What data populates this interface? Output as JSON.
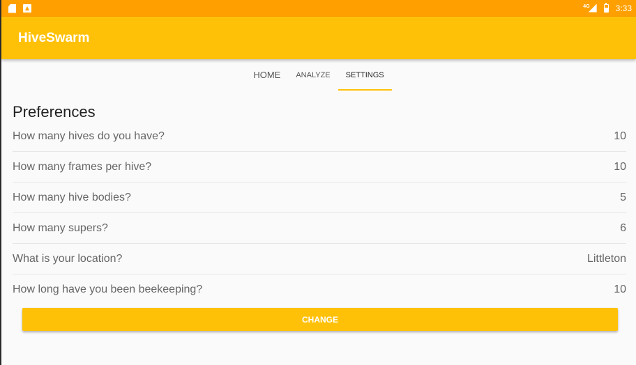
{
  "status_bar": {
    "net_type": "4G",
    "time": "3:33"
  },
  "app": {
    "title": "HiveSwarm"
  },
  "tabs": [
    {
      "label": "HOME"
    },
    {
      "label": "ANALYZE"
    },
    {
      "label": "SETTINGS",
      "selected": true
    }
  ],
  "preferences": {
    "title": "Preferences",
    "rows": [
      {
        "question": "How many hives do you have?",
        "value": "10"
      },
      {
        "question": "How many frames per hive?",
        "value": "10"
      },
      {
        "question": "How many hive bodies?",
        "value": "5"
      },
      {
        "question": "How many supers?",
        "value": "6"
      },
      {
        "question": "What is your location?",
        "value": "Littleton"
      },
      {
        "question": "How long have you been beekeeping?",
        "value": "10"
      }
    ],
    "change_label": "CHANGE"
  },
  "colors": {
    "status_bar": "#ffa000",
    "primary": "#ffc107",
    "background": "#fafafa"
  }
}
